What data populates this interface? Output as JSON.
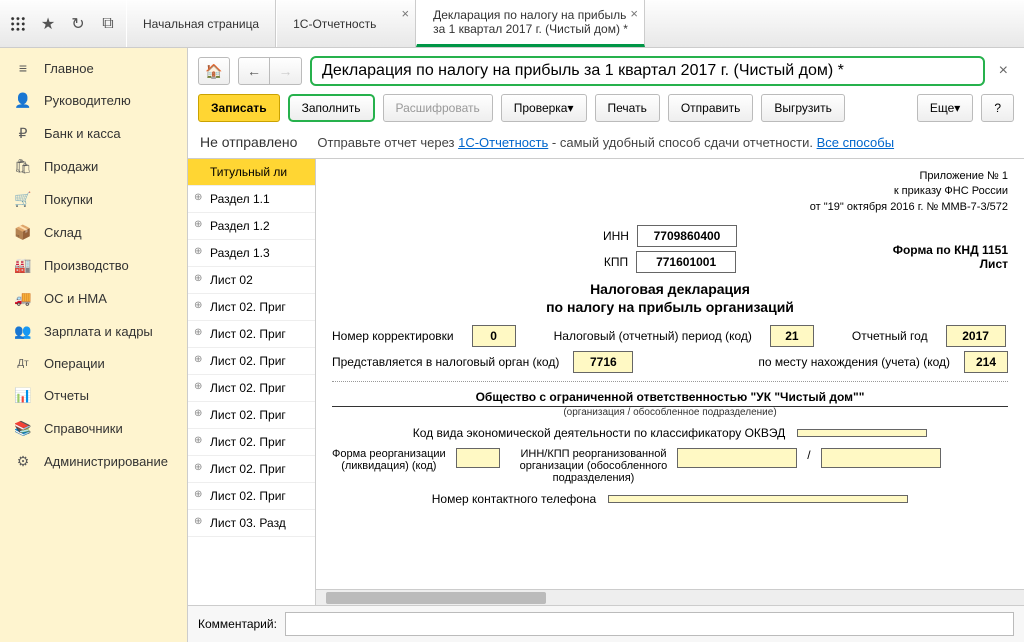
{
  "topbar": {
    "tabs": [
      {
        "line1": "Начальная страница",
        "line2": ""
      },
      {
        "line1": "1С-Отчетность",
        "line2": ""
      },
      {
        "line1": "Декларация по налогу на прибыль",
        "line2": "за 1 квартал 2017 г. (Чистый дом) *"
      }
    ]
  },
  "sidebar": [
    {
      "icon": "≡",
      "label": "Главное"
    },
    {
      "icon": "👤",
      "label": "Руководителю"
    },
    {
      "icon": "₽",
      "label": "Банк и касса"
    },
    {
      "icon": "🛍",
      "label": "Продажи"
    },
    {
      "icon": "🛒",
      "label": "Покупки"
    },
    {
      "icon": "📦",
      "label": "Склад"
    },
    {
      "icon": "🏭",
      "label": "Производство"
    },
    {
      "icon": "🚚",
      "label": "ОС и НМА"
    },
    {
      "icon": "👥",
      "label": "Зарплата и кадры"
    },
    {
      "icon": "Дт",
      "label": "Операции"
    },
    {
      "icon": "📊",
      "label": "Отчеты"
    },
    {
      "icon": "📚",
      "label": "Справочники"
    },
    {
      "icon": "⚙",
      "label": "Администрирование"
    }
  ],
  "doc_title": "Декларация по налогу на прибыль за 1 квартал 2017 г. (Чистый дом) *",
  "toolbar": {
    "save": "Записать",
    "fill": "Заполнить",
    "decode": "Расшифровать",
    "check": "Проверка",
    "print": "Печать",
    "send": "Отправить",
    "export": "Выгрузить",
    "more": "Еще",
    "help": "?"
  },
  "status": {
    "label": "Не отправлено",
    "text1": "Отправьте отчет через ",
    "link1": "1С-Отчетность",
    "text2": " - самый удобный способ сдачи отчетности. ",
    "link2": "Все способы"
  },
  "tree": [
    "Титульный ли",
    "Раздел 1.1",
    "Раздел 1.2",
    "Раздел 1.3",
    "Лист 02",
    "Лист 02. Приг",
    "Лист 02. Приг",
    "Лист 02. Приг",
    "Лист 02. Приг",
    "Лист 02. Приг",
    "Лист 02. Приг",
    "Лист 02. Приг",
    "Лист 02. Приг",
    "Лист 03. Разд"
  ],
  "form": {
    "hdr1": "Приложение № 1",
    "hdr2": "к приказу ФНС России",
    "hdr3": "от \"19\" октября 2016 г. № ММВ-7-3/572",
    "knd": "Форма по КНД 1151",
    "list": "Лист",
    "inn_label": "ИНН",
    "inn": "7709860400",
    "kpp_label": "КПП",
    "kpp": "771601001",
    "title1": "Налоговая декларация",
    "title2": "по налогу на прибыль организаций",
    "corr_label": "Номер корректировки",
    "corr": "0",
    "period_label": "Налоговый (отчетный) период (код)",
    "period": "21",
    "year_label": "Отчетный год",
    "year": "2017",
    "organ_label": "Представляется в налоговый орган (код)",
    "organ": "7716",
    "place_label": "по месту нахождения (учета) (код)",
    "place": "214",
    "org_name": "Общество с ограниченной ответственностью \"УК \"Чистый дом\"\"",
    "org_sub": "(организация / обособленное подразделение)",
    "okved_label": "Код вида экономической деятельности по классификатору ОКВЭД",
    "reorg_label1": "Форма реорганизации",
    "reorg_label2": "(ликвидация) (код)",
    "reorg_inn_l1": "ИНН/КПП реорганизованной",
    "reorg_inn_l2": "организации (обособленного",
    "reorg_inn_l3": "подразделения)",
    "phone_label": "Номер контактного телефона",
    "slash": "/"
  },
  "comment_label": "Комментарий:"
}
